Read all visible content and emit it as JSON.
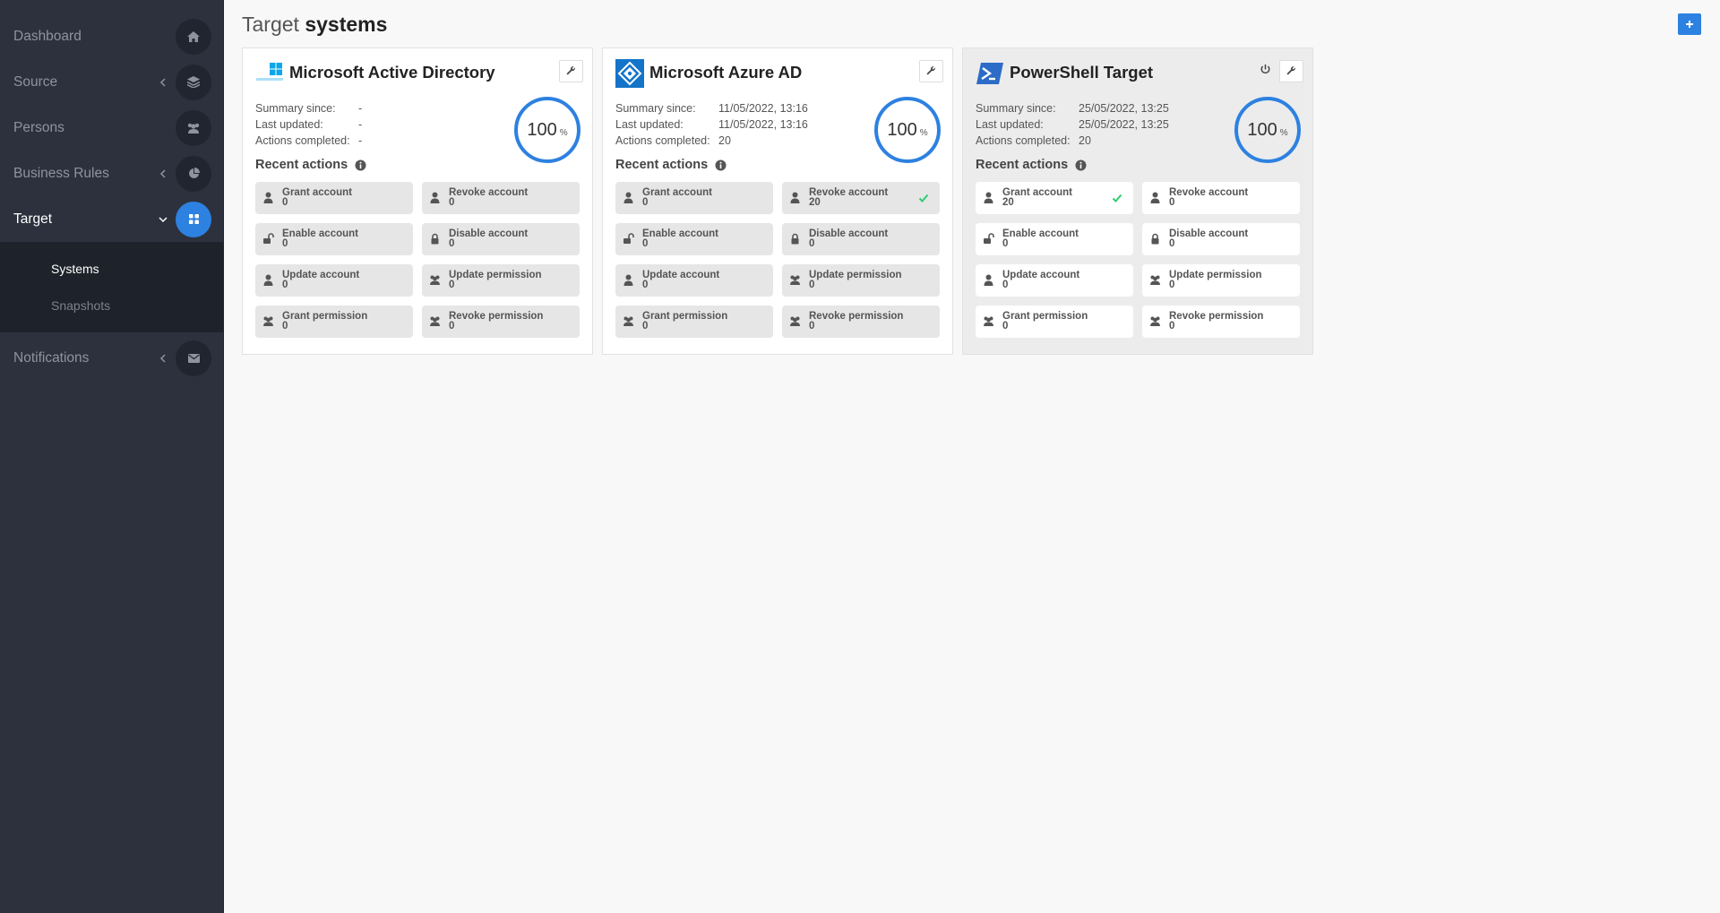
{
  "sidebar": {
    "items": [
      {
        "label": "Dashboard",
        "icon": "home-icon"
      },
      {
        "label": "Source",
        "icon": "layers-icon"
      },
      {
        "label": "Persons",
        "icon": "users-icon"
      },
      {
        "label": "Business Rules",
        "icon": "pie-chart-icon"
      },
      {
        "label": "Target",
        "icon": "grid-icon"
      },
      {
        "label": "Notifications",
        "icon": "envelope-icon"
      }
    ],
    "target_submenu": [
      {
        "label": "Systems"
      },
      {
        "label": "Snapshots"
      }
    ]
  },
  "header": {
    "title_prefix": "Target",
    "title_bold": "systems",
    "add_label": "+"
  },
  "colors": {
    "accent": "#2d81e0",
    "sidebar_bg": "#2c313d",
    "success": "#2ecc71"
  },
  "cards": [
    {
      "name": "Microsoft Active Directory",
      "logo": "windows-server-logo",
      "summary_since_label": "Summary since:",
      "summary_since": "-",
      "last_updated_label": "Last updated:",
      "last_updated": "-",
      "actions_completed_label": "Actions completed:",
      "actions_completed": "-",
      "percent": "100",
      "percent_unit": "%",
      "recent_label": "Recent actions",
      "actions": [
        {
          "label": "Grant account",
          "count": "0"
        },
        {
          "label": "Revoke account",
          "count": "0"
        },
        {
          "label": "Enable account",
          "count": "0"
        },
        {
          "label": "Disable account",
          "count": "0"
        },
        {
          "label": "Update account",
          "count": "0"
        },
        {
          "label": "Update permission",
          "count": "0"
        },
        {
          "label": "Grant permission",
          "count": "0"
        },
        {
          "label": "Revoke permission",
          "count": "0"
        }
      ]
    },
    {
      "name": "Microsoft Azure AD",
      "logo": "azure-ad-logo",
      "summary_since_label": "Summary since:",
      "summary_since": "11/05/2022, 13:16",
      "last_updated_label": "Last updated:",
      "last_updated": "11/05/2022, 13:16",
      "actions_completed_label": "Actions completed:",
      "actions_completed": "20",
      "percent": "100",
      "percent_unit": "%",
      "recent_label": "Recent actions",
      "actions": [
        {
          "label": "Grant account",
          "count": "0"
        },
        {
          "label": "Revoke account",
          "count": "20"
        },
        {
          "label": "Enable account",
          "count": "0"
        },
        {
          "label": "Disable account",
          "count": "0"
        },
        {
          "label": "Update account",
          "count": "0"
        },
        {
          "label": "Update permission",
          "count": "0"
        },
        {
          "label": "Grant permission",
          "count": "0"
        },
        {
          "label": "Revoke permission",
          "count": "0"
        }
      ]
    },
    {
      "name": "PowerShell Target",
      "logo": "powershell-logo",
      "summary_since_label": "Summary since:",
      "summary_since": "25/05/2022, 13:25",
      "last_updated_label": "Last updated:",
      "last_updated": "25/05/2022, 13:25",
      "actions_completed_label": "Actions completed:",
      "actions_completed": "20",
      "percent": "100",
      "percent_unit": "%",
      "recent_label": "Recent actions",
      "actions": [
        {
          "label": "Grant account",
          "count": "20"
        },
        {
          "label": "Revoke account",
          "count": "0"
        },
        {
          "label": "Enable account",
          "count": "0"
        },
        {
          "label": "Disable account",
          "count": "0"
        },
        {
          "label": "Update account",
          "count": "0"
        },
        {
          "label": "Update permission",
          "count": "0"
        },
        {
          "label": "Grant permission",
          "count": "0"
        },
        {
          "label": "Revoke permission",
          "count": "0"
        }
      ]
    }
  ]
}
